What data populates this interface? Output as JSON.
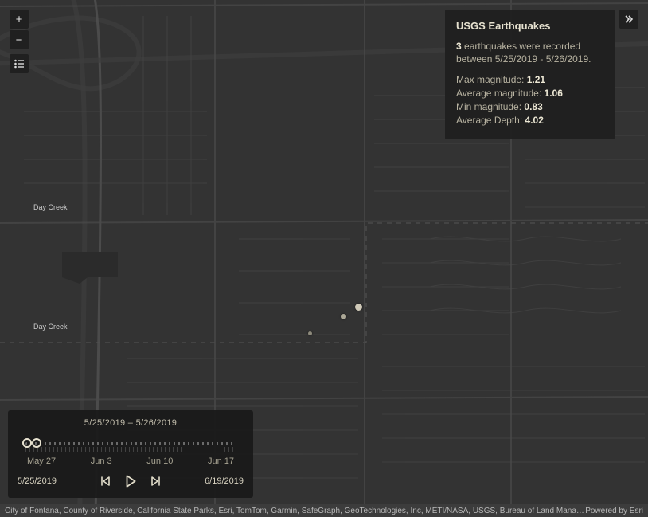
{
  "panel": {
    "title": "USGS Earthquakes",
    "count": "3",
    "summary_tail": " earthquakes were recorded between 5/25/2019 - 5/26/2019.",
    "max_label": "Max magnitude: ",
    "max_value": "1.21",
    "avg_label": "Average magnitude: ",
    "avg_value": "1.06",
    "min_label": "Min magnitude: ",
    "min_value": "0.83",
    "depth_label": "Average Depth: ",
    "depth_value": "4.02"
  },
  "zoom": {
    "in_glyph": "+",
    "out_glyph": "−"
  },
  "time": {
    "range_label": "5/25/2019  –  5/26/2019",
    "ticks": {
      "t1": "May 27",
      "t2": "Jun 3",
      "t3": "Jun 10",
      "t4": "Jun 17"
    },
    "start": "5/25/2019",
    "end": "6/19/2019"
  },
  "attribution": {
    "left": "City of Fontana, County of Riverside, California State Parks, Esri, TomTom, Garmin, SafeGraph, GeoTechnologies, Inc, METI/NASA, USGS, Bureau of Land Management, EPA, NP…",
    "right": "Powered by Esri"
  },
  "map": {
    "creek_label": "Day Creek"
  }
}
